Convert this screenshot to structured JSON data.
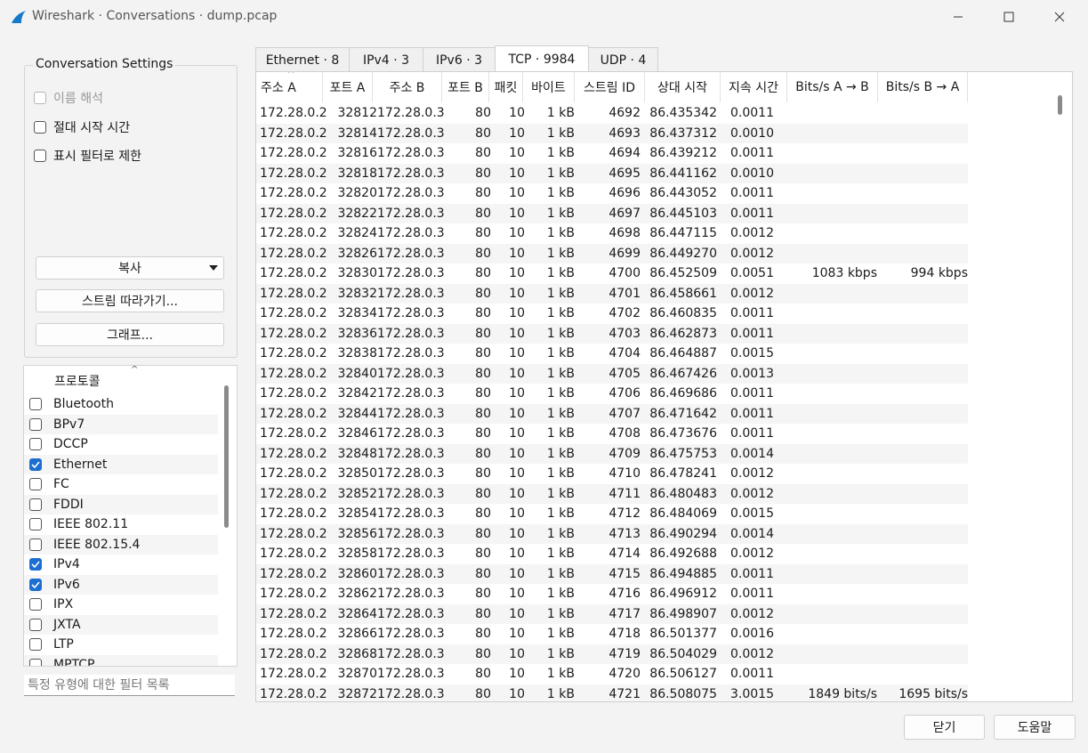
{
  "window": {
    "title": "Wireshark · Conversations · dump.pcap"
  },
  "settings": {
    "group_title": "Conversation Settings",
    "name_resolution": {
      "label": "이름 해석",
      "checked": false,
      "disabled": true
    },
    "absolute_start": {
      "label": "절대 시작 시간",
      "checked": false
    },
    "limit_filter": {
      "label": "표시 필터로 제한",
      "checked": false
    },
    "copy_button": "복사",
    "follow_stream_button": "스트림 따라가기...",
    "graph_button": "그래프..."
  },
  "protocols": {
    "header": "프로토콜",
    "items": [
      {
        "label": "Bluetooth",
        "checked": false
      },
      {
        "label": "BPv7",
        "checked": false
      },
      {
        "label": "DCCP",
        "checked": false
      },
      {
        "label": "Ethernet",
        "checked": true
      },
      {
        "label": "FC",
        "checked": false
      },
      {
        "label": "FDDI",
        "checked": false
      },
      {
        "label": "IEEE 802.11",
        "checked": false
      },
      {
        "label": "IEEE 802.15.4",
        "checked": false
      },
      {
        "label": "IPv4",
        "checked": true
      },
      {
        "label": "IPv6",
        "checked": true
      },
      {
        "label": "IPX",
        "checked": false
      },
      {
        "label": "JXTA",
        "checked": false
      },
      {
        "label": "LTP",
        "checked": false
      },
      {
        "label": "MPTCP",
        "checked": false
      }
    ],
    "filter_placeholder": "특정 유형에 대한 필터 목록"
  },
  "tabs": [
    {
      "label": "Ethernet · 8",
      "active": false
    },
    {
      "label": "IPv4 · 3",
      "active": false
    },
    {
      "label": "IPv6 · 3",
      "active": false
    },
    {
      "label": "TCP · 9984",
      "active": true
    },
    {
      "label": "UDP · 4",
      "active": false
    }
  ],
  "table": {
    "columns": [
      "주소 A",
      "포트 A",
      "주소 B",
      "포트 B",
      "패킷",
      "바이트",
      "스트림 ID",
      "상대 시작",
      "지속 시간",
      "Bits/s A → B",
      "Bits/s B → A"
    ],
    "rows": [
      [
        "172.28.0.2",
        "32812",
        "172.28.0.3",
        "80",
        "10",
        "1 kB",
        "4692",
        "86.435342",
        "0.0011",
        "",
        ""
      ],
      [
        "172.28.0.2",
        "32814",
        "172.28.0.3",
        "80",
        "10",
        "1 kB",
        "4693",
        "86.437312",
        "0.0010",
        "",
        ""
      ],
      [
        "172.28.0.2",
        "32816",
        "172.28.0.3",
        "80",
        "10",
        "1 kB",
        "4694",
        "86.439212",
        "0.0011",
        "",
        ""
      ],
      [
        "172.28.0.2",
        "32818",
        "172.28.0.3",
        "80",
        "10",
        "1 kB",
        "4695",
        "86.441162",
        "0.0010",
        "",
        ""
      ],
      [
        "172.28.0.2",
        "32820",
        "172.28.0.3",
        "80",
        "10",
        "1 kB",
        "4696",
        "86.443052",
        "0.0011",
        "",
        ""
      ],
      [
        "172.28.0.2",
        "32822",
        "172.28.0.3",
        "80",
        "10",
        "1 kB",
        "4697",
        "86.445103",
        "0.0011",
        "",
        ""
      ],
      [
        "172.28.0.2",
        "32824",
        "172.28.0.3",
        "80",
        "10",
        "1 kB",
        "4698",
        "86.447115",
        "0.0012",
        "",
        ""
      ],
      [
        "172.28.0.2",
        "32826",
        "172.28.0.3",
        "80",
        "10",
        "1 kB",
        "4699",
        "86.449270",
        "0.0012",
        "",
        ""
      ],
      [
        "172.28.0.2",
        "32830",
        "172.28.0.3",
        "80",
        "10",
        "1 kB",
        "4700",
        "86.452509",
        "0.0051",
        "1083 kbps",
        "994 kbps"
      ],
      [
        "172.28.0.2",
        "32832",
        "172.28.0.3",
        "80",
        "10",
        "1 kB",
        "4701",
        "86.458661",
        "0.0012",
        "",
        ""
      ],
      [
        "172.28.0.2",
        "32834",
        "172.28.0.3",
        "80",
        "10",
        "1 kB",
        "4702",
        "86.460835",
        "0.0011",
        "",
        ""
      ],
      [
        "172.28.0.2",
        "32836",
        "172.28.0.3",
        "80",
        "10",
        "1 kB",
        "4703",
        "86.462873",
        "0.0011",
        "",
        ""
      ],
      [
        "172.28.0.2",
        "32838",
        "172.28.0.3",
        "80",
        "10",
        "1 kB",
        "4704",
        "86.464887",
        "0.0015",
        "",
        ""
      ],
      [
        "172.28.0.2",
        "32840",
        "172.28.0.3",
        "80",
        "10",
        "1 kB",
        "4705",
        "86.467426",
        "0.0013",
        "",
        ""
      ],
      [
        "172.28.0.2",
        "32842",
        "172.28.0.3",
        "80",
        "10",
        "1 kB",
        "4706",
        "86.469686",
        "0.0011",
        "",
        ""
      ],
      [
        "172.28.0.2",
        "32844",
        "172.28.0.3",
        "80",
        "10",
        "1 kB",
        "4707",
        "86.471642",
        "0.0011",
        "",
        ""
      ],
      [
        "172.28.0.2",
        "32846",
        "172.28.0.3",
        "80",
        "10",
        "1 kB",
        "4708",
        "86.473676",
        "0.0011",
        "",
        ""
      ],
      [
        "172.28.0.2",
        "32848",
        "172.28.0.3",
        "80",
        "10",
        "1 kB",
        "4709",
        "86.475753",
        "0.0014",
        "",
        ""
      ],
      [
        "172.28.0.2",
        "32850",
        "172.28.0.3",
        "80",
        "10",
        "1 kB",
        "4710",
        "86.478241",
        "0.0012",
        "",
        ""
      ],
      [
        "172.28.0.2",
        "32852",
        "172.28.0.3",
        "80",
        "10",
        "1 kB",
        "4711",
        "86.480483",
        "0.0012",
        "",
        ""
      ],
      [
        "172.28.0.2",
        "32854",
        "172.28.0.3",
        "80",
        "10",
        "1 kB",
        "4712",
        "86.484069",
        "0.0015",
        "",
        ""
      ],
      [
        "172.28.0.2",
        "32856",
        "172.28.0.3",
        "80",
        "10",
        "1 kB",
        "4713",
        "86.490294",
        "0.0014",
        "",
        ""
      ],
      [
        "172.28.0.2",
        "32858",
        "172.28.0.3",
        "80",
        "10",
        "1 kB",
        "4714",
        "86.492688",
        "0.0012",
        "",
        ""
      ],
      [
        "172.28.0.2",
        "32860",
        "172.28.0.3",
        "80",
        "10",
        "1 kB",
        "4715",
        "86.494885",
        "0.0011",
        "",
        ""
      ],
      [
        "172.28.0.2",
        "32862",
        "172.28.0.3",
        "80",
        "10",
        "1 kB",
        "4716",
        "86.496912",
        "0.0011",
        "",
        ""
      ],
      [
        "172.28.0.2",
        "32864",
        "172.28.0.3",
        "80",
        "10",
        "1 kB",
        "4717",
        "86.498907",
        "0.0012",
        "",
        ""
      ],
      [
        "172.28.0.2",
        "32866",
        "172.28.0.3",
        "80",
        "10",
        "1 kB",
        "4718",
        "86.501377",
        "0.0016",
        "",
        ""
      ],
      [
        "172.28.0.2",
        "32868",
        "172.28.0.3",
        "80",
        "10",
        "1 kB",
        "4719",
        "86.504029",
        "0.0012",
        "",
        ""
      ],
      [
        "172.28.0.2",
        "32870",
        "172.28.0.3",
        "80",
        "10",
        "1 kB",
        "4720",
        "86.506127",
        "0.0011",
        "",
        ""
      ],
      [
        "172.28.0.2",
        "32872",
        "172.28.0.3",
        "80",
        "10",
        "1 kB",
        "4721",
        "86.508075",
        "3.0015",
        "1849 bits/s",
        "1695 bits/s"
      ]
    ]
  },
  "footer": {
    "close_button": "닫기",
    "help_button": "도움말"
  },
  "colors": {
    "accent": "#1c6fd0",
    "window_bg": "#f3f3f3",
    "alt_row": "#f5f5f5"
  }
}
